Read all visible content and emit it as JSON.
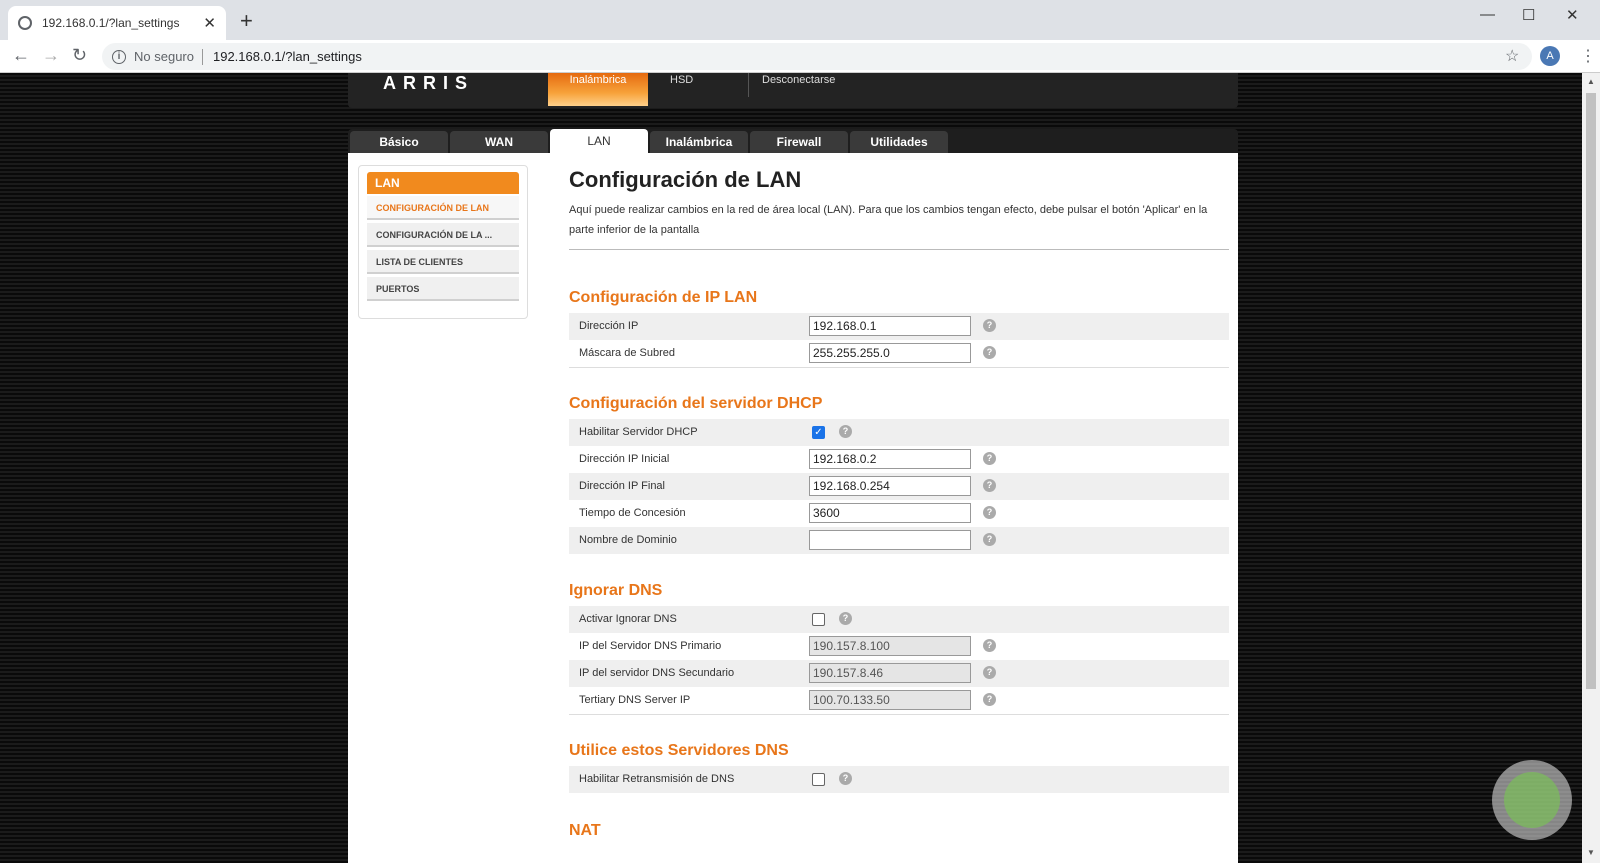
{
  "browser": {
    "tab_title": "192.168.0.1/?lan_settings",
    "security": "No seguro",
    "url": "192.168.0.1/?lan_settings",
    "avatar_letter": "A"
  },
  "header": {
    "logo": "ARRIS",
    "nav": [
      "Inalámbrica",
      "HSD",
      "Desconectarse"
    ]
  },
  "tabs": [
    "Básico",
    "WAN",
    "LAN",
    "Inalámbrica",
    "Firewall",
    "Utilidades"
  ],
  "sidebar": {
    "heading": "LAN",
    "items": [
      "CONFIGURACIÓN DE LAN",
      "CONFIGURACIÓN DE LA ...",
      "LISTA DE CLIENTES",
      "PUERTOS"
    ]
  },
  "main": {
    "title": "Configuración de LAN",
    "intro": "Aquí puede realizar cambios en la red de área local (LAN). Para que los cambios tengan efecto, debe pulsar el botón 'Aplicar' en la parte inferior de la pantalla",
    "ip_section": {
      "title": "Configuración de IP LAN",
      "ip_label": "Dirección IP",
      "ip_value": "192.168.0.1",
      "mask_label": "Máscara de Subred",
      "mask_value": "255.255.255.0"
    },
    "dhcp_section": {
      "title": "Configuración del servidor DHCP",
      "enable_label": "Habilitar Servidor DHCP",
      "start_label": "Dirección IP Inicial",
      "start_value": "192.168.0.2",
      "end_label": "Dirección IP Final",
      "end_value": "192.168.0.254",
      "lease_label": "Tiempo de Concesión",
      "lease_value": "3600",
      "domain_label": "Nombre de Dominio",
      "domain_value": ""
    },
    "dns_section": {
      "title": "Ignorar DNS",
      "enable_label": "Activar Ignorar DNS",
      "primary_label": "IP del Servidor DNS Primario",
      "primary_value": "190.157.8.100",
      "secondary_label": "IP del servidor DNS Secundario",
      "secondary_value": "190.157.8.46",
      "tertiary_label": "Tertiary DNS Server IP",
      "tertiary_value": "100.70.133.50"
    },
    "relay_section": {
      "title": "Utilice estos Servidores DNS",
      "relay_label": "Habilitar Retransmisión de DNS"
    },
    "nat_section": {
      "title": "NAT"
    },
    "help_glyph": "?"
  }
}
